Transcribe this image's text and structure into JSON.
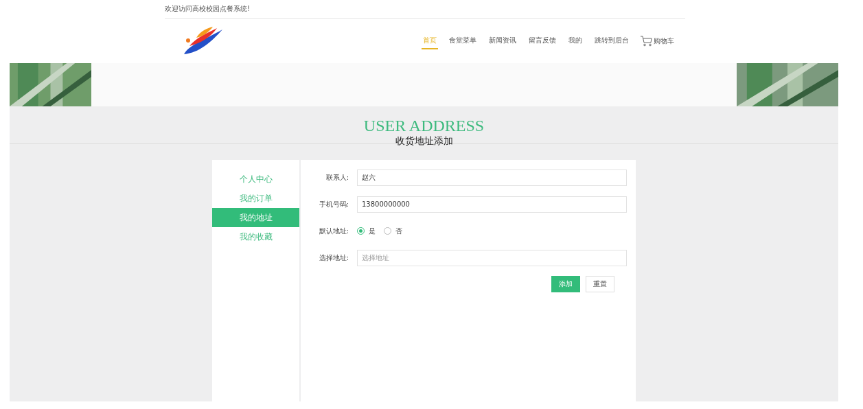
{
  "welcome": "欢迎访问高校校园点餐系统!",
  "nav": [
    {
      "label": "首页",
      "selected": true
    },
    {
      "label": "食堂菜单",
      "selected": false
    },
    {
      "label": "新闻资讯",
      "selected": false
    },
    {
      "label": "留言反馈",
      "selected": false
    },
    {
      "label": "我的",
      "selected": false
    },
    {
      "label": "跳转到后台",
      "selected": false
    }
  ],
  "cart": {
    "label": "购物车"
  },
  "section": {
    "title": "USER ADDRESS",
    "subtitle": "收货地址添加"
  },
  "sidebar": [
    {
      "label": "个人中心",
      "selected": false
    },
    {
      "label": "我的订单",
      "selected": false
    },
    {
      "label": "我的地址",
      "selected": true
    },
    {
      "label": "我的收藏",
      "selected": false
    }
  ],
  "form": [
    {
      "kind": "text",
      "label": "联系人:",
      "value": "赵六"
    },
    {
      "kind": "text",
      "label": "手机号码:",
      "value": "13800000000"
    },
    {
      "kind": "radio",
      "label": "默认地址:",
      "options": [
        {
          "label": "是",
          "selected": true
        },
        {
          "label": "否",
          "selected": false
        }
      ]
    },
    {
      "kind": "text",
      "label": "选择地址:",
      "placeholder": "选择地址"
    }
  ],
  "buttons": [
    {
      "label": "添加",
      "kind": "primary"
    },
    {
      "label": "重置",
      "kind": "plain"
    }
  ]
}
